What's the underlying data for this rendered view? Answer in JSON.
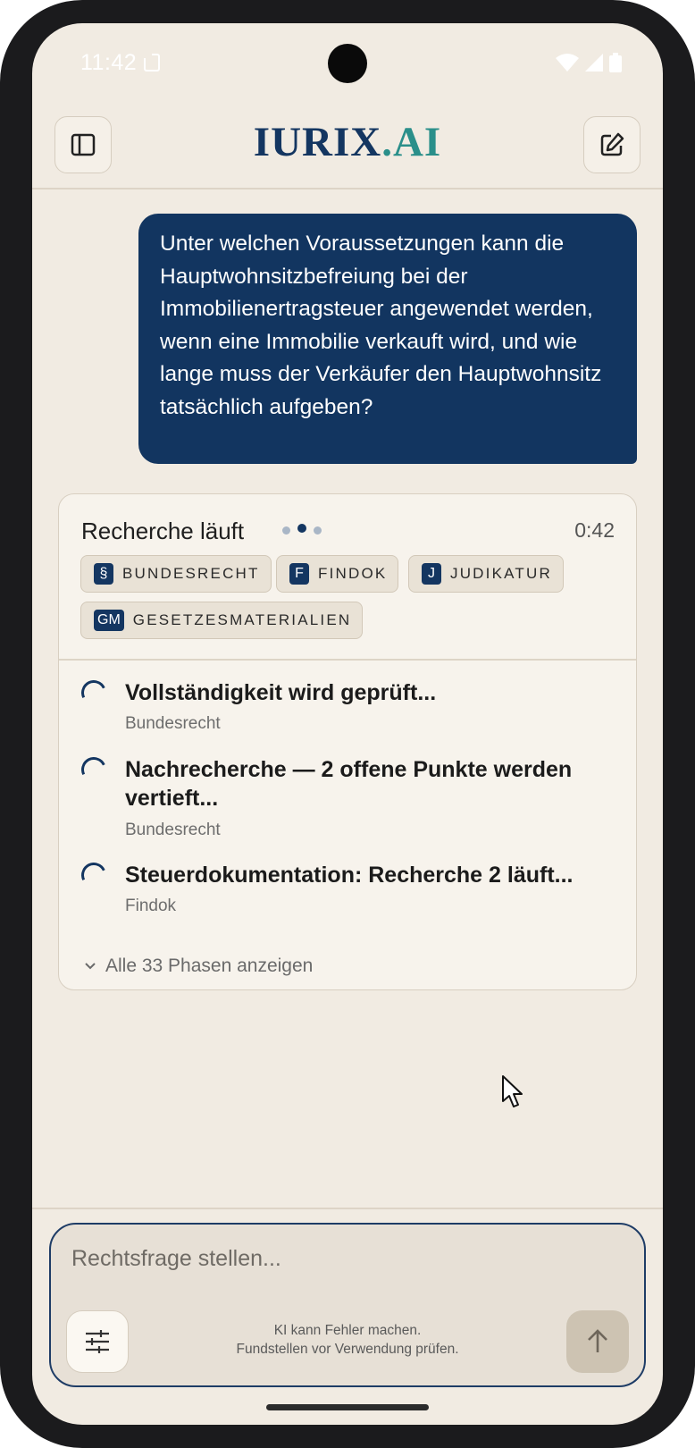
{
  "status_bar": {
    "time": "11:42"
  },
  "header": {
    "brand_main": "IURIX",
    "brand_suffix": ".AI",
    "sidebar_icon": "sidebar-icon",
    "new_chat_icon": "edit-icon"
  },
  "user_message": {
    "text": "Unter welchen Voraussetzungen kann die Hauptwohnsitzbefreiung bei der Immobilienertragsteuer angewendet werden, wenn eine Immobilie verkauft wird, und wie lange muss der Verkäufer den Hauptwohnsitz tatsächlich aufgeben?"
  },
  "research": {
    "title": "Recherche läuft",
    "timer": "0:42",
    "sources": [
      {
        "icon": "§",
        "label": "BUNDESRECHT"
      },
      {
        "icon": "F",
        "label": "FINDOK"
      },
      {
        "icon": "J",
        "label": "JUDIKATUR"
      },
      {
        "icon": "GM",
        "label": "GESETZESMATERIALIEN"
      }
    ],
    "phases": [
      {
        "title": "Vollständigkeit wird geprüft...",
        "source": "Bundesrecht"
      },
      {
        "title": "Nachrecherche — 2 offene Punkte werden vertieft...",
        "source": "Bundesrecht"
      },
      {
        "title": "Steuerdokumentation: Recherche 2 läuft...",
        "source": "Findok"
      }
    ],
    "show_all": "Alle 33 Phasen anzeigen"
  },
  "composer": {
    "placeholder": "Rechtsfrage stellen...",
    "disclaimer_line1": "KI kann Fehler machen.",
    "disclaimer_line2": "Fundstellen vor Verwendung prüfen."
  },
  "colors": {
    "primary": "#143661",
    "accent": "#2a8f8a",
    "background": "#f1ebe2"
  }
}
